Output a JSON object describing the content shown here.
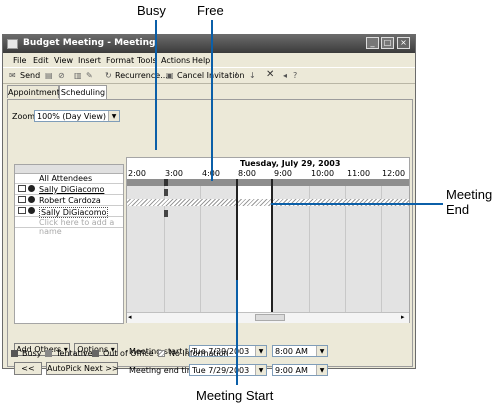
{
  "callouts": {
    "busy": "Busy",
    "free": "Free",
    "meeting_end": "Meeting\nEnd",
    "meeting_start": "Meeting Start"
  },
  "window": {
    "title": "Budget Meeting - Meeting",
    "controls": [
      "_",
      "□",
      "×"
    ]
  },
  "menu": [
    "File",
    "Edit",
    "View",
    "Insert",
    "Format",
    "Tools",
    "Actions",
    "Help"
  ],
  "toolbar": {
    "send": "Send",
    "recurrence": "Recurrence...",
    "cancel_invitation": "Cancel Invitation"
  },
  "tabs": [
    "Appointment",
    "Scheduling"
  ],
  "active_tab": "Scheduling",
  "zoom": {
    "label": "Zoom:",
    "value": "100% (Day View)"
  },
  "schedule": {
    "date": "Tuesday, July 29, 2003",
    "times": [
      "2:00",
      "3:00",
      "4:00",
      "8:00",
      "9:00",
      "10:00",
      "11:00",
      "12:00"
    ],
    "all_attendees": "All Attendees",
    "attendees": [
      "Sally DiGiacomo",
      "Robert Cardoza",
      "Sally DiGiacomo"
    ],
    "add_name_placeholder": "Click here to add a name"
  },
  "buttons": {
    "add_others": "Add Others",
    "options": "Options",
    "prev": "<<",
    "autopick_next": "AutoPick Next >>"
  },
  "meeting": {
    "start_label": "Meeting start time:",
    "start_date": "Tue 7/29/2003",
    "start_time": "8:00 AM",
    "end_label": "Meeting end time:",
    "end_date": "Tue 7/29/2003",
    "end_time": "9:00 AM"
  },
  "legend": [
    "Busy",
    "Tentative",
    "Out of Office",
    "No Information"
  ],
  "colors": {
    "busy": "#555555",
    "callout_line": "#0b5fa8",
    "title_bar": "#4a4a4a"
  }
}
